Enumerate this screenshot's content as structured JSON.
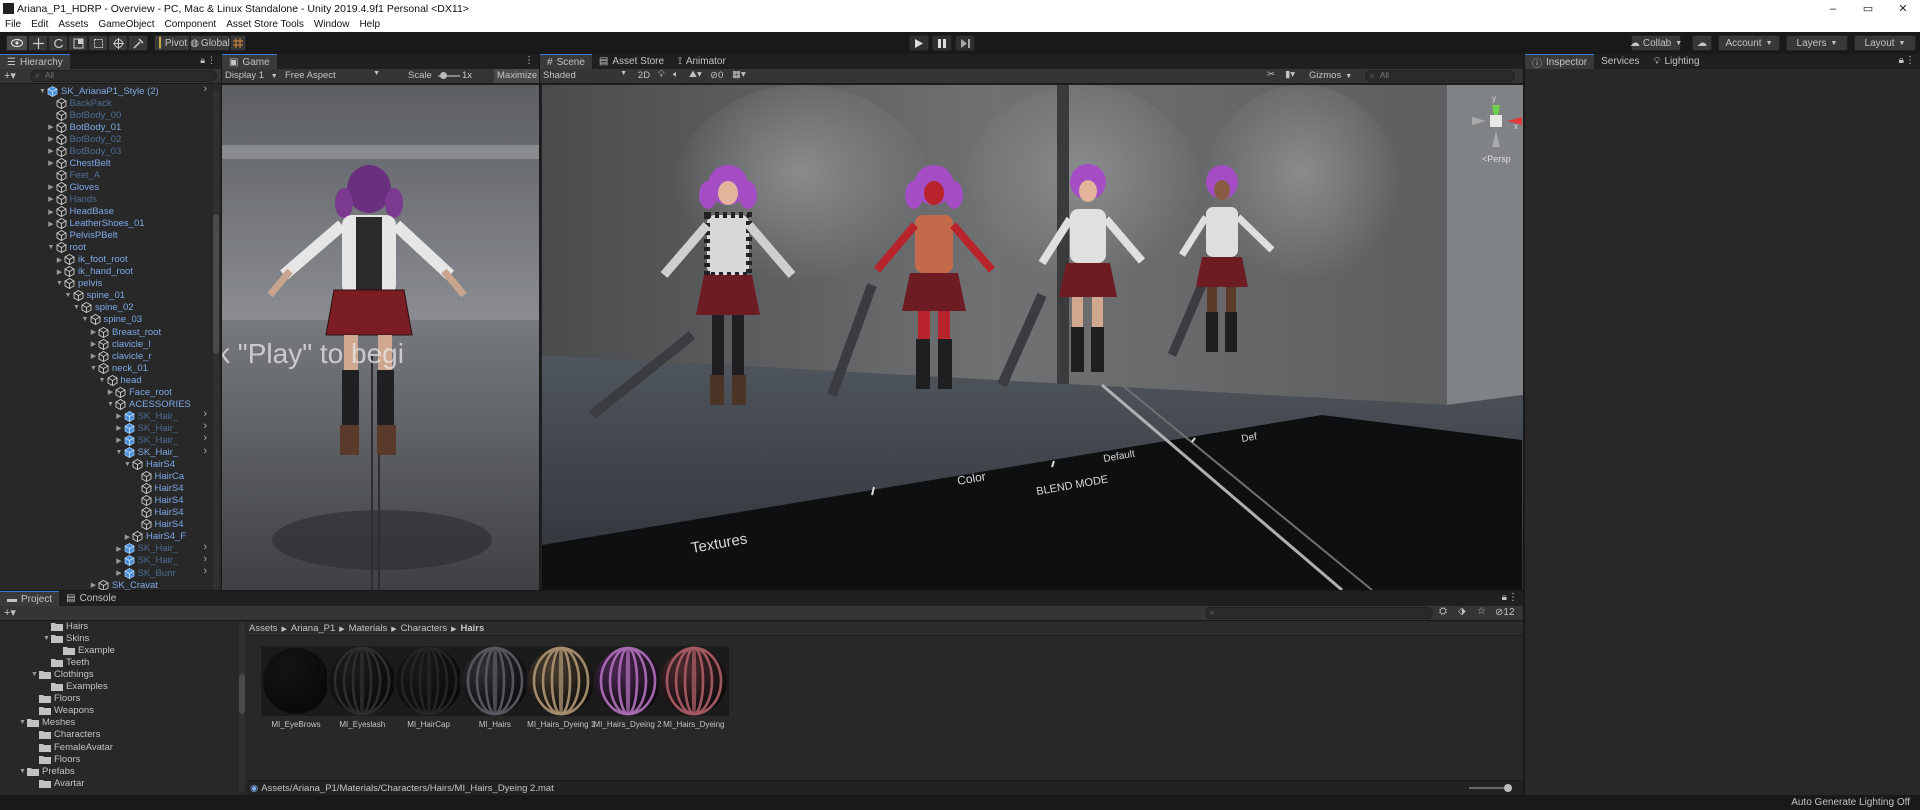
{
  "window": {
    "title": "Ariana_P1_HDRP - Overview - PC, Mac & Linux Standalone - Unity 2019.4.9f1 Personal <DX11>",
    "minimize": "–",
    "maximize": "▭",
    "close": "✕"
  },
  "menu": [
    "File",
    "Edit",
    "Assets",
    "GameObject",
    "Component",
    "Asset Store Tools",
    "Window",
    "Help"
  ],
  "toolbar": {
    "pivot": "Pivot",
    "global": "Global",
    "collab": "Collab",
    "account": "Account",
    "layers": "Layers",
    "layout": "Layout"
  },
  "hierarchy": {
    "tab": "Hierarchy",
    "search_placeholder": "All",
    "items": [
      {
        "label": "SK_ArianaP1_Style (2)",
        "indent": 0,
        "arrow": "▼",
        "style": "blue",
        "icon": "prefab"
      },
      {
        "label": "BackPack",
        "indent": 1,
        "arrow": "",
        "style": "dim",
        "icon": "cube"
      },
      {
        "label": "BotBody_00",
        "indent": 1,
        "arrow": "",
        "style": "dim",
        "icon": "cube"
      },
      {
        "label": "BotBody_01",
        "indent": 1,
        "arrow": "▶",
        "style": "blue",
        "icon": "cube"
      },
      {
        "label": "BotBody_02",
        "indent": 1,
        "arrow": "▶",
        "style": "dim",
        "icon": "cube"
      },
      {
        "label": "BotBody_03",
        "indent": 1,
        "arrow": "▶",
        "style": "dim",
        "icon": "cube"
      },
      {
        "label": "ChestBelt",
        "indent": 1,
        "arrow": "▶",
        "style": "blue",
        "icon": "cube"
      },
      {
        "label": "Feet_A",
        "indent": 1,
        "arrow": "",
        "style": "dim",
        "icon": "cube"
      },
      {
        "label": "Gloves",
        "indent": 1,
        "arrow": "▶",
        "style": "blue",
        "icon": "cube"
      },
      {
        "label": "Hands",
        "indent": 1,
        "arrow": "▶",
        "style": "dim",
        "icon": "cube"
      },
      {
        "label": "HeadBase",
        "indent": 1,
        "arrow": "▶",
        "style": "blue",
        "icon": "cube"
      },
      {
        "label": "LeatherShoes_01",
        "indent": 1,
        "arrow": "▶",
        "style": "blue",
        "icon": "cube"
      },
      {
        "label": "PelvisPBelt",
        "indent": 1,
        "arrow": "",
        "style": "blue",
        "icon": "cube"
      },
      {
        "label": "root",
        "indent": 1,
        "arrow": "▼",
        "style": "blue",
        "icon": "cube"
      },
      {
        "label": "ik_foot_root",
        "indent": 2,
        "arrow": "▶",
        "style": "blue",
        "icon": "cube"
      },
      {
        "label": "ik_hand_root",
        "indent": 2,
        "arrow": "▶",
        "style": "blue",
        "icon": "cube"
      },
      {
        "label": "pelvis",
        "indent": 2,
        "arrow": "▼",
        "style": "blue",
        "icon": "cube"
      },
      {
        "label": "spine_01",
        "indent": 3,
        "arrow": "▼",
        "style": "blue",
        "icon": "cube"
      },
      {
        "label": "spine_02",
        "indent": 4,
        "arrow": "▼",
        "style": "blue",
        "icon": "cube"
      },
      {
        "label": "spine_03",
        "indent": 5,
        "arrow": "▼",
        "style": "blue",
        "icon": "cube"
      },
      {
        "label": "Breast_root",
        "indent": 6,
        "arrow": "▶",
        "style": "blue",
        "icon": "cube"
      },
      {
        "label": "clavicle_l",
        "indent": 6,
        "arrow": "▶",
        "style": "blue",
        "icon": "cube"
      },
      {
        "label": "clavicle_r",
        "indent": 6,
        "arrow": "▶",
        "style": "blue",
        "icon": "cube"
      },
      {
        "label": "neck_01",
        "indent": 6,
        "arrow": "▼",
        "style": "blue",
        "icon": "cube"
      },
      {
        "label": "head",
        "indent": 7,
        "arrow": "▼",
        "style": "blue",
        "icon": "cube"
      },
      {
        "label": "Face_root",
        "indent": 8,
        "arrow": "▶",
        "style": "blue",
        "icon": "cube"
      },
      {
        "label": "ACESSORIES",
        "indent": 8,
        "arrow": "▼",
        "style": "blue",
        "icon": "cube"
      },
      {
        "label": "SK_Hair_",
        "indent": 9,
        "arrow": "▶",
        "style": "dim",
        "icon": "prefab"
      },
      {
        "label": "SK_Hair_",
        "indent": 9,
        "arrow": "▶",
        "style": "dim",
        "icon": "prefab"
      },
      {
        "label": "SK_Hair_",
        "indent": 9,
        "arrow": "▶",
        "style": "dim",
        "icon": "prefab"
      },
      {
        "label": "SK_Hair_",
        "indent": 9,
        "arrow": "▼",
        "style": "blue",
        "icon": "prefab"
      },
      {
        "label": "HairS4",
        "indent": 10,
        "arrow": "▼",
        "style": "blue",
        "icon": "cube"
      },
      {
        "label": "HairCa",
        "indent": 11,
        "arrow": "",
        "style": "blue",
        "icon": "cube"
      },
      {
        "label": "HairS4",
        "indent": 11,
        "arrow": "",
        "style": "blue",
        "icon": "cube"
      },
      {
        "label": "HairS4",
        "indent": 11,
        "arrow": "",
        "style": "blue",
        "icon": "cube"
      },
      {
        "label": "HairS4",
        "indent": 11,
        "arrow": "",
        "style": "blue",
        "icon": "cube"
      },
      {
        "label": "HairS4",
        "indent": 11,
        "arrow": "",
        "style": "blue",
        "icon": "cube"
      },
      {
        "label": "HairS4_F",
        "indent": 10,
        "arrow": "▶",
        "style": "blue",
        "icon": "cube"
      },
      {
        "label": "SK_Hair_",
        "indent": 9,
        "arrow": "▶",
        "style": "dim",
        "icon": "prefab"
      },
      {
        "label": "SK_Hair_",
        "indent": 9,
        "arrow": "▶",
        "style": "dim",
        "icon": "prefab"
      },
      {
        "label": "SK_Bunr",
        "indent": 9,
        "arrow": "▶",
        "style": "dim",
        "icon": "prefab"
      },
      {
        "label": "SK_Cravat",
        "indent": 6,
        "arrow": "▶",
        "style": "blue",
        "icon": "cube"
      }
    ]
  },
  "game": {
    "tab": "Game",
    "display": "Display 1",
    "aspect": "Free Aspect",
    "scale_label": "Scale",
    "scale_value": "1x",
    "maximize": "Maximize",
    "overlay": "k \"Play\" to begi"
  },
  "scene": {
    "tabs": [
      "Scene",
      "Asset Store",
      "Animator"
    ],
    "shading": "Shaded",
    "mode2d": "2D",
    "fx_count": "0",
    "gizmos": "Gizmos",
    "search_placeholder": "All",
    "persp": "<Persp",
    "floor_labels": [
      "Textures",
      "Color",
      "BLEND MODE",
      "Default",
      "Def"
    ],
    "accent": "#3a7be0"
  },
  "inspector": {
    "tabs": [
      "Inspector",
      "Services",
      "Lighting"
    ]
  },
  "project": {
    "tabs": [
      "Project",
      "Console"
    ],
    "hidden_count": "12",
    "folders": [
      {
        "label": "Hairs",
        "indent": 3,
        "arrow": ""
      },
      {
        "label": "Skins",
        "indent": 3,
        "arrow": "▼"
      },
      {
        "label": "Example",
        "indent": 4,
        "arrow": ""
      },
      {
        "label": "Teeth",
        "indent": 3,
        "arrow": ""
      },
      {
        "label": "Clothings",
        "indent": 2,
        "arrow": "▼"
      },
      {
        "label": "Examples",
        "indent": 3,
        "arrow": ""
      },
      {
        "label": "Floors",
        "indent": 2,
        "arrow": ""
      },
      {
        "label": "Weapons",
        "indent": 2,
        "arrow": ""
      },
      {
        "label": "Meshes",
        "indent": 1,
        "arrow": "▼"
      },
      {
        "label": "Characters",
        "indent": 2,
        "arrow": ""
      },
      {
        "label": "FemaleAvatar",
        "indent": 2,
        "arrow": ""
      },
      {
        "label": "Floors",
        "indent": 2,
        "arrow": ""
      },
      {
        "label": "Prefabs",
        "indent": 1,
        "arrow": "▼"
      },
      {
        "label": "Avartar",
        "indent": 2,
        "arrow": ""
      }
    ],
    "breadcrumb": [
      "Assets",
      "Ariana_P1",
      "Materials",
      "Characters",
      "Hairs"
    ],
    "materials": [
      {
        "label": "MI_EyeBrows",
        "color": "#141414",
        "stripes": false
      },
      {
        "label": "MI_Eyeslash",
        "color": "#1c1c1c",
        "stripes": true,
        "stripe": "#2e2e2e"
      },
      {
        "label": "MI_HairCap",
        "color": "#1a1a1a",
        "stripes": true,
        "stripe": "#262626"
      },
      {
        "label": "MI_Hairs",
        "color": "#2f3136",
        "stripes": true,
        "stripe": "#56595e"
      },
      {
        "label": "MI_Hairs_Dyeing 1",
        "color": "#4a3e31",
        "stripes": true,
        "stripe": "#a58e6e"
      },
      {
        "label": "MI_Hairs_Dyeing 2",
        "color": "#4a2752",
        "stripes": true,
        "stripe": "#a76ab2"
      },
      {
        "label": "MI_Hairs_Dyeing",
        "color": "#4a2b2f",
        "stripes": true,
        "stripe": "#a55a63"
      }
    ],
    "path": "Assets/Ariana_P1/Materials/Characters/Hairs/MI_Hairs_Dyeing 2.mat"
  },
  "status": {
    "right": "Auto Generate Lighting Off"
  }
}
